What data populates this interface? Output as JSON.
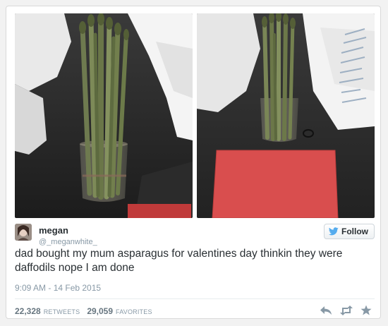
{
  "tweet": {
    "display_name": "megan",
    "handle": "@_meganwhite_",
    "text": "dad bought my mum asparagus for valentines day thinkin they were daffodils nope I am done",
    "timestamp": "9:09 AM - 14 Feb 2015",
    "retweets_count": "22,328",
    "retweets_label": "RETWEETS",
    "favorites_count": "29,059",
    "favorites_label": "FAVORITES",
    "follow_label": "Follow"
  },
  "colors": {
    "brand_blue": "#55acee",
    "text": "#292f33",
    "muted": "#8899a6",
    "envelope_red": "#d94e4e"
  },
  "icons": {
    "follow": "twitter-bird-icon",
    "reply": "reply-icon",
    "retweet": "retweet-icon",
    "favorite": "star-icon"
  }
}
